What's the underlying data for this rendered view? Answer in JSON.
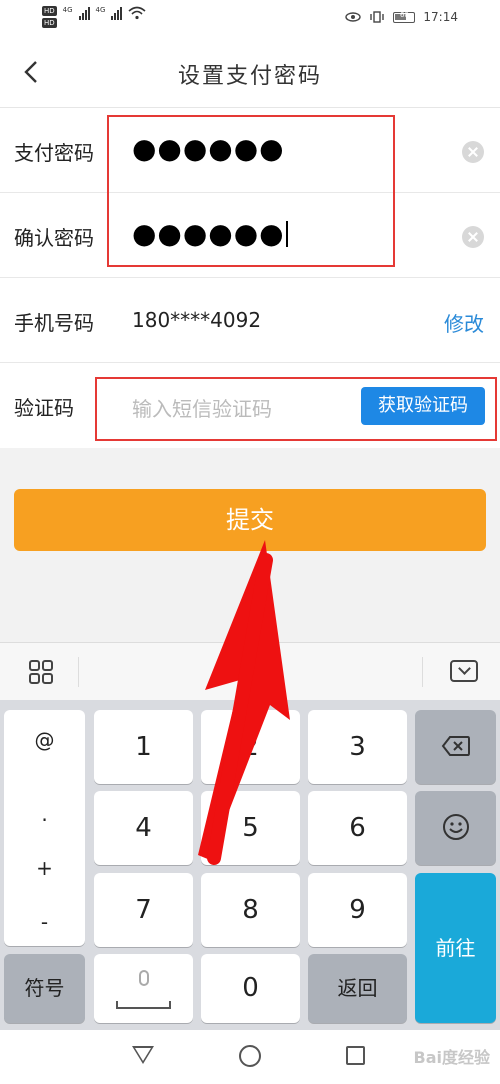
{
  "status_bar": {
    "network_1": "4G",
    "network_2": "4G",
    "battery": "60",
    "time": "17:14"
  },
  "header": {
    "title": "设置支付密码"
  },
  "form": {
    "pay_password": {
      "label": "支付密码",
      "value": "●●●●●●"
    },
    "confirm_password": {
      "label": "确认密码",
      "value": "●●●●●●"
    },
    "phone": {
      "label": "手机号码",
      "value": "180****4092",
      "action": "修改"
    },
    "sms_code": {
      "label": "验证码",
      "placeholder": "输入短信验证码",
      "button": "获取验证码"
    }
  },
  "submit_label": "提交",
  "keyboard": {
    "symbols": [
      "@",
      ".",
      "+",
      "-"
    ],
    "digits": [
      "1",
      "2",
      "3",
      "4",
      "5",
      "6",
      "7",
      "8",
      "9",
      "0"
    ],
    "symbol_key": "符号",
    "return_key": "返回",
    "go_key": "前往"
  },
  "watermark": "Bai度经验",
  "colors": {
    "accent_blue": "#1e88e5",
    "submit_orange": "#f7a021",
    "annotation_red": "#e53935",
    "go_key": "#1aa9d9"
  }
}
